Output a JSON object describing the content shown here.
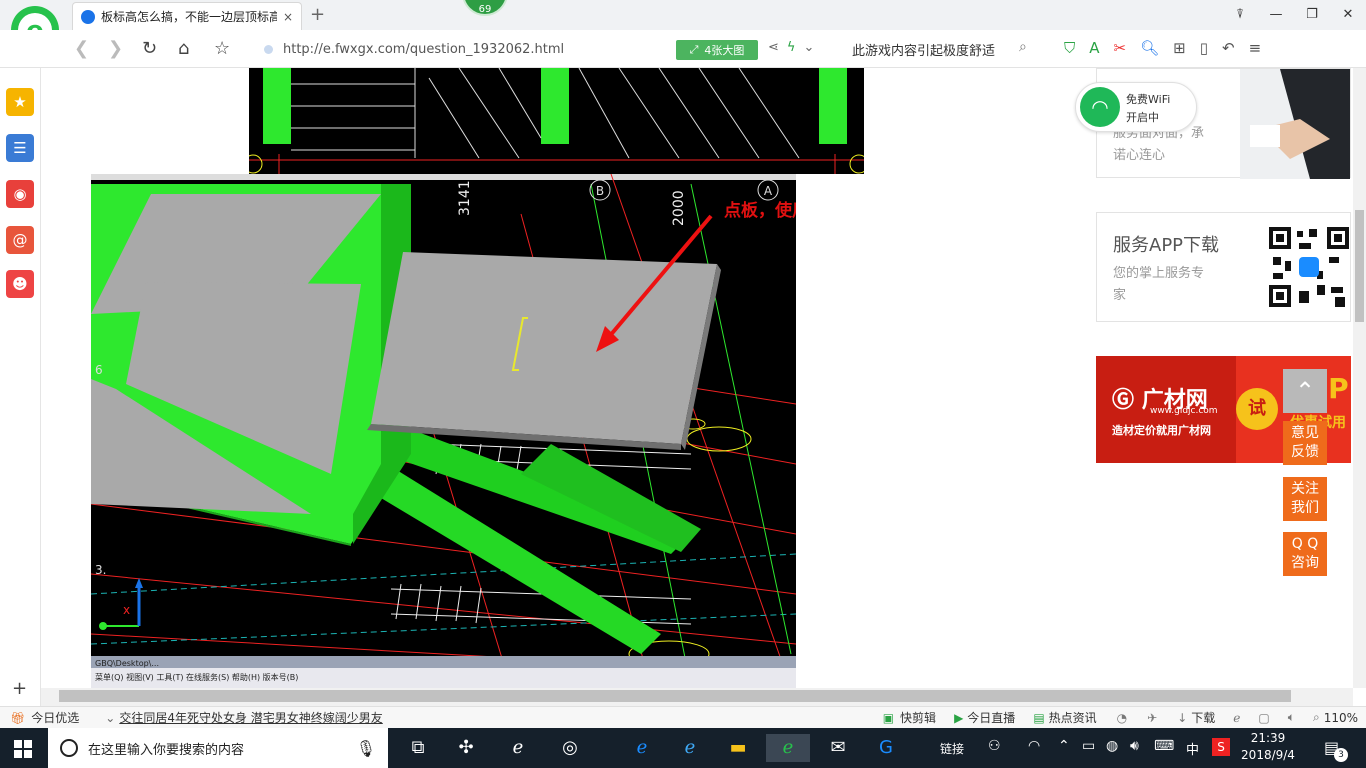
{
  "browser": {
    "tab_title": "板标高怎么搞，不能一边层顶标高",
    "tab_close": "×",
    "new_tab": "+",
    "badge_number": "69",
    "window_controls": [
      "⍒",
      "—",
      "❐",
      "✕"
    ],
    "url": "http://e.fwxgx.com/question_1932062.html",
    "image_button": "4张大图",
    "search_text": "此游戏内容引起极度舒适",
    "zoom": "110%"
  },
  "sidebar": {
    "items": [
      "favorites-icon",
      "list-icon",
      "weibo-icon",
      "mail-icon",
      "game-icon"
    ],
    "add_label": "+"
  },
  "page": {
    "annotation": "点板，使用三点定义斜板功能",
    "cad_labels": {
      "dim1": "3141",
      "dim2": "2000",
      "axis_b": "B",
      "axis_a": "A",
      "left6": "6",
      "left3": "3."
    },
    "cad_menu": "菜单(Q)  视图(V)  工具(T)  在线服务(S)  帮助(H)  版本号(B)",
    "cad_title": "GBQ\\Desktop\\...",
    "wifi": {
      "label1": "免费WiFi",
      "label2": "开启中"
    },
    "service_text": [
      "服务面对面，承",
      "诺心连心"
    ],
    "app_card": {
      "title": "服务APP下载",
      "desc1": "您的掌上服务专",
      "desc2": "家"
    },
    "banner": {
      "brand": "广材网",
      "domain": "www.gldjc.com",
      "slogan": "造材定价就用广材网",
      "try": "试",
      "vip": "VIP",
      "vip_sub": "优惠试用"
    },
    "float_buttons": [
      {
        "l1": "意见",
        "l2": "反馈"
      },
      {
        "l1": "关注",
        "l2": "我们"
      },
      {
        "l1": "Q Q",
        "l2": "咨询"
      }
    ]
  },
  "statusbar": {
    "today": "今日优选",
    "news": "交往同居4年死守处女身 潜宅男女神终嫁阔少男友",
    "quick_cut": "快剪辑",
    "live": "今日直播",
    "hot": "热点资讯",
    "download": "下载"
  },
  "taskbar": {
    "search_placeholder": "在这里输入你要搜索的内容",
    "link": "链接",
    "lang": "中",
    "time": "21:39",
    "date": "2018/9/4",
    "notif_count": "3"
  }
}
